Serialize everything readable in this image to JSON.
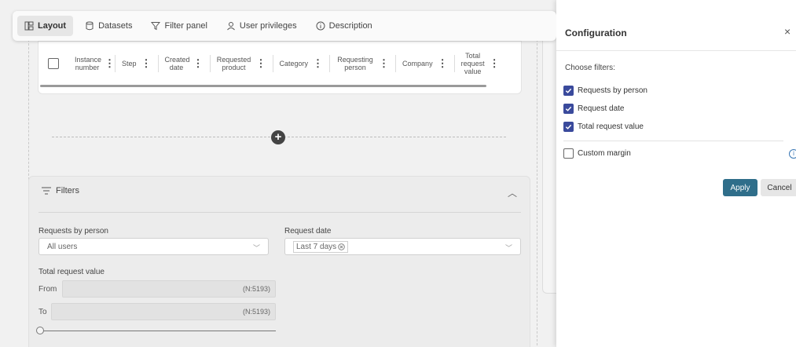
{
  "toolbar": {
    "tabs": [
      {
        "label": "Layout",
        "icon": "layout-icon",
        "active": true
      },
      {
        "label": "Datasets",
        "icon": "database-icon",
        "active": false
      },
      {
        "label": "Filter panel",
        "icon": "filter-icon",
        "active": false
      },
      {
        "label": "User privileges",
        "icon": "user-icon",
        "active": false
      },
      {
        "label": "Description",
        "icon": "info-icon",
        "active": false
      }
    ]
  },
  "table": {
    "columns": [
      "Instance number",
      "Step",
      "Created date",
      "Requested product",
      "Category",
      "Requesting person",
      "Company",
      "Total request value"
    ]
  },
  "add": {
    "symbol": "+"
  },
  "filters": {
    "header": "Filters",
    "requests_by_person": {
      "label": "Requests by person",
      "value": "All users"
    },
    "request_date": {
      "label": "Request date",
      "value": "Last 7 days"
    },
    "total_request_value": {
      "label": "Total request value",
      "from_label": "From",
      "to_label": "To",
      "from_hint": "(N:5193)",
      "to_hint": "(N:5193)",
      "slider_position": 0
    }
  },
  "config_panel": {
    "title": "Configuration",
    "close": "×",
    "choose_label": "Choose filters:",
    "options": [
      {
        "label": "Requests by person",
        "checked": true
      },
      {
        "label": "Request date",
        "checked": true
      },
      {
        "label": "Total request value",
        "checked": true
      }
    ],
    "custom_margin": {
      "label": "Custom margin",
      "checked": false
    },
    "info_glyph": "i",
    "apply_label": "Apply",
    "cancel_label": "Cancel"
  },
  "colors": {
    "checkbox_on": "#3a4a9c",
    "apply_button": "#2f6e8a",
    "info_icon": "#3a78b5"
  }
}
